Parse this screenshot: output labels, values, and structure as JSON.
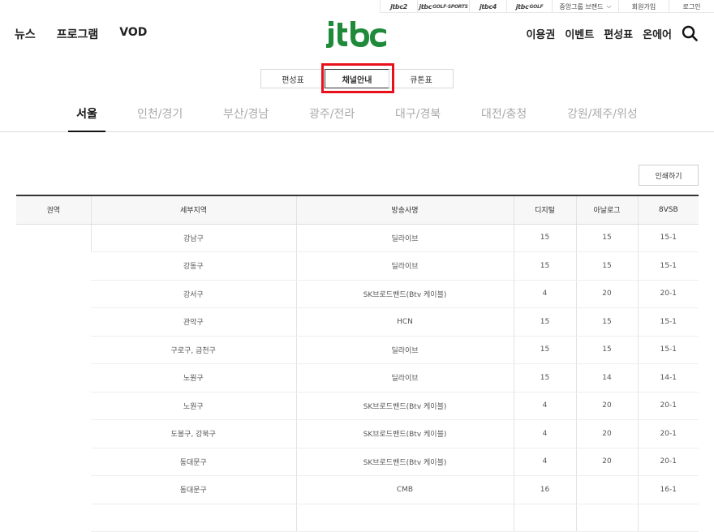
{
  "topbar": {
    "items": [
      {
        "label": "jtbc2",
        "sup": ""
      },
      {
        "label": "jtbc",
        "sup": "GOLF·SPORTS"
      },
      {
        "label": "jtbc4",
        "sup": ""
      },
      {
        "label": "jtbc",
        "sup": "GOLF"
      },
      {
        "label": "중앙그룹 브랜드",
        "sup": ""
      },
      {
        "label": "회원가입",
        "sup": ""
      },
      {
        "label": "로그인",
        "sup": ""
      }
    ]
  },
  "header": {
    "nav_left": [
      "뉴스",
      "프로그램",
      "VOD"
    ],
    "nav_right": [
      "이용권",
      "이벤트",
      "편성표",
      "온에어"
    ],
    "logo_text": "jtbc",
    "brand_colors": {
      "green": "#1f8a3a",
      "dark": "#111111",
      "highlight": "#e8101b"
    }
  },
  "subtabs": [
    "편성표",
    "채널안내",
    "큐톤표"
  ],
  "regions": [
    "서울",
    "인천/경기",
    "부산/경남",
    "광주/전라",
    "대구/경북",
    "대전/충청",
    "강원/제주/위성"
  ],
  "print_label": "인쇄하기",
  "table": {
    "headers": [
      "권역",
      "세부지역",
      "방송사명",
      "디지털",
      "아날로그",
      "8VSB"
    ],
    "rows": [
      [
        "강남구",
        "딜라이브",
        "15",
        "15",
        "15-1"
      ],
      [
        "강동구",
        "딜라이브",
        "15",
        "15",
        "15-1"
      ],
      [
        "강서구",
        "SK브로드밴드(Btv 케이블)",
        "4",
        "20",
        "20-1"
      ],
      [
        "관악구",
        "HCN",
        "15",
        "15",
        "15-1"
      ],
      [
        "구로구, 금천구",
        "딜라이브",
        "15",
        "15",
        "15-1"
      ],
      [
        "노원구",
        "딜라이브",
        "15",
        "14",
        "14-1"
      ],
      [
        "노원구",
        "SK브로드밴드(Btv 케이블)",
        "4",
        "20",
        "20-1"
      ],
      [
        "도봉구, 강북구",
        "SK브로드밴드(Btv 케이블)",
        "4",
        "20",
        "20-1"
      ],
      [
        "동대문구",
        "SK브로드밴드(Btv 케이블)",
        "4",
        "20",
        "20-1"
      ],
      [
        "동대문구",
        "CMB",
        "16",
        "",
        "16-1"
      ],
      [
        "",
        "",
        "",
        "",
        ""
      ]
    ]
  }
}
